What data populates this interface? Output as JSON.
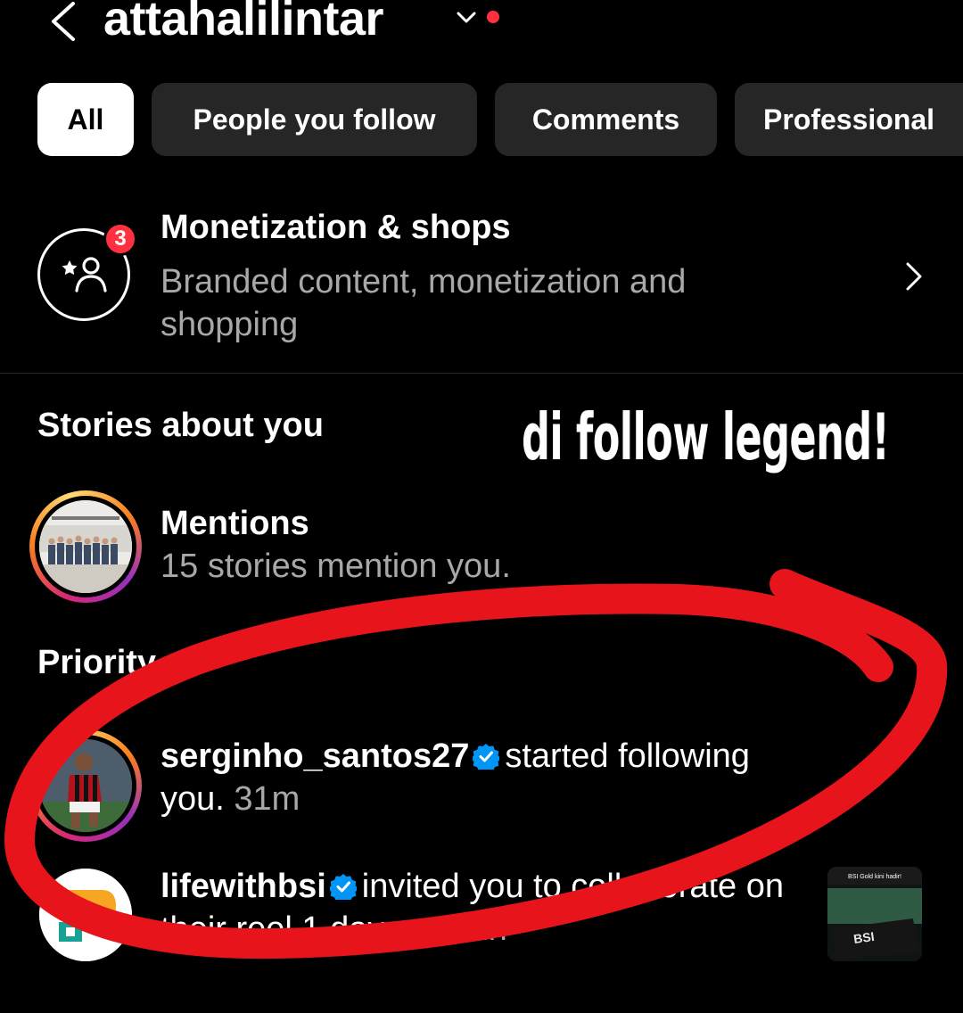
{
  "header": {
    "username": "attahalilintar",
    "back_icon": "chevron-left-icon",
    "dropdown_icon": "chevron-down-icon"
  },
  "tabs": [
    {
      "label": "All",
      "active": true
    },
    {
      "label": "People you follow",
      "active": false
    },
    {
      "label": "Comments",
      "active": false
    },
    {
      "label": "Professional",
      "active": false
    }
  ],
  "monetization": {
    "title": "Monetization & shops",
    "subtitle": "Branded content, monetization and shopping",
    "badge_count": "3",
    "icon": "star-person-icon"
  },
  "stories": {
    "section_title": "Stories about you",
    "mentions_title": "Mentions",
    "mentions_subtitle": "15 stories mention you."
  },
  "overlay_caption": "di follow legend!",
  "priority": {
    "section_title": "Priority",
    "notifications": [
      {
        "username": "serginho_santos27",
        "verified": true,
        "action": "started following you.",
        "time": "31m"
      },
      {
        "username": "lifewithbsi",
        "verified": true,
        "action": "invited you to collaborate on their reel 1 day ago.",
        "time": "1h"
      }
    ],
    "thumbnail_text": "BSI Gold kini hadir!",
    "thumbnail_logo": "BSI"
  },
  "colors": {
    "background": "#000000",
    "tab_inactive": "#262626",
    "badge_red": "#ff3040",
    "verified_blue": "#0095f6",
    "secondary_text": "#a8a8a8",
    "scribble_red": "#e8141b"
  }
}
